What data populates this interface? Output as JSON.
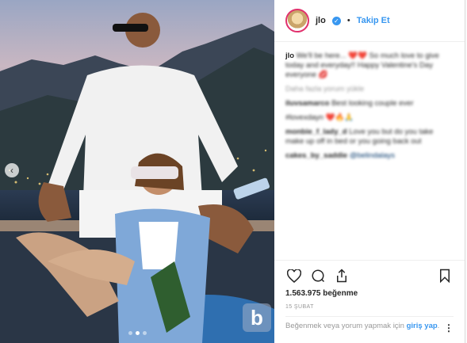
{
  "header": {
    "username": "jlo",
    "separator": "•",
    "follow_label": "Takip Et"
  },
  "comments": [
    {
      "user": "jlo",
      "text": "We'll be here... ❤️❤️ So much love to give today and everyday!! Happy Valentine's Day everyone 💋"
    },
    {
      "user": "",
      "text": "Daha fazla yorum yükle"
    },
    {
      "user": "iluvsamarco",
      "text": "Best looking couple ever"
    },
    {
      "user": "",
      "text": "#lovexdayn ❤️🔥🙏"
    },
    {
      "user": "monbie_f_lady_d",
      "text": "Love you but do you take make up off in bed or you going back out"
    },
    {
      "user": "cakes_by_saddie",
      "text": "@belindalays"
    }
  ],
  "actions": {
    "likes": "1.563.975 beğenme",
    "date": "15 ŞUBAT",
    "login_prefix": "Beğenmek veya yorum yapmak için ",
    "login_link": "giriş yap",
    "login_suffix": ".",
    "more": "⋮"
  },
  "watermark": "b",
  "colors": {
    "accent": "#3897f0",
    "text": "#262626",
    "muted": "#999999"
  }
}
